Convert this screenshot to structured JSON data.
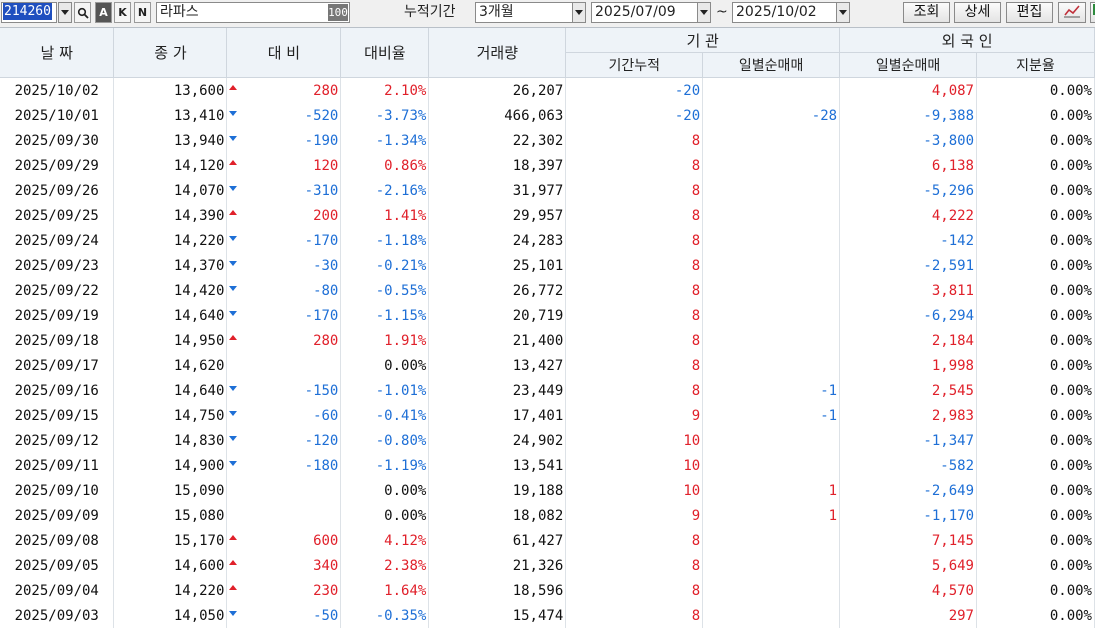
{
  "toolbar": {
    "code": "214260",
    "btn_a": "A",
    "btn_k": "K",
    "btn_n": "N",
    "name": "라파스",
    "badge": "100",
    "period_label": "누적기간",
    "period": "3개월",
    "start_date": "2025/07/09",
    "tilde": "~",
    "end_date": "2025/10/02",
    "search": "조회",
    "detail": "상세",
    "edit": "편집"
  },
  "columns": {
    "date": "날 짜",
    "close": "종 가",
    "change": "대 비",
    "rate": "대비율",
    "volume": "거래량",
    "inst_group": "기 관",
    "inst_cum": "기간누적",
    "inst_daily": "일별순매매",
    "foreign_group": "외 국 인",
    "foreign_daily": "일별순매매",
    "foreign_ratio": "지분율"
  },
  "colors": {
    "up": "#e0202a",
    "down": "#1e6fd6",
    "neutral": "#111111",
    "header": "#eef3f8"
  },
  "rows": [
    {
      "date": "2025/10/02",
      "close": "13,600",
      "dir": "up",
      "change": "280",
      "rate": "2.10%",
      "volume": "26,207",
      "inst_cum": "-20",
      "inst_daily": "",
      "foreign_daily": "4,087",
      "foreign_ratio": "0.00%"
    },
    {
      "date": "2025/10/01",
      "close": "13,410",
      "dir": "down",
      "change": "-520",
      "rate": "-3.73%",
      "volume": "466,063",
      "inst_cum": "-20",
      "inst_daily": "-28",
      "foreign_daily": "-9,388",
      "foreign_ratio": "0.00%"
    },
    {
      "date": "2025/09/30",
      "close": "13,940",
      "dir": "down",
      "change": "-190",
      "rate": "-1.34%",
      "volume": "22,302",
      "inst_cum": "8",
      "inst_daily": "",
      "foreign_daily": "-3,800",
      "foreign_ratio": "0.00%"
    },
    {
      "date": "2025/09/29",
      "close": "14,120",
      "dir": "up",
      "change": "120",
      "rate": "0.86%",
      "volume": "18,397",
      "inst_cum": "8",
      "inst_daily": "",
      "foreign_daily": "6,138",
      "foreign_ratio": "0.00%"
    },
    {
      "date": "2025/09/26",
      "close": "14,070",
      "dir": "down",
      "change": "-310",
      "rate": "-2.16%",
      "volume": "31,977",
      "inst_cum": "8",
      "inst_daily": "",
      "foreign_daily": "-5,296",
      "foreign_ratio": "0.00%"
    },
    {
      "date": "2025/09/25",
      "close": "14,390",
      "dir": "up",
      "change": "200",
      "rate": "1.41%",
      "volume": "29,957",
      "inst_cum": "8",
      "inst_daily": "",
      "foreign_daily": "4,222",
      "foreign_ratio": "0.00%"
    },
    {
      "date": "2025/09/24",
      "close": "14,220",
      "dir": "down",
      "change": "-170",
      "rate": "-1.18%",
      "volume": "24,283",
      "inst_cum": "8",
      "inst_daily": "",
      "foreign_daily": "-142",
      "foreign_ratio": "0.00%"
    },
    {
      "date": "2025/09/23",
      "close": "14,370",
      "dir": "down",
      "change": "-30",
      "rate": "-0.21%",
      "volume": "25,101",
      "inst_cum": "8",
      "inst_daily": "",
      "foreign_daily": "-2,591",
      "foreign_ratio": "0.00%"
    },
    {
      "date": "2025/09/22",
      "close": "14,420",
      "dir": "down",
      "change": "-80",
      "rate": "-0.55%",
      "volume": "26,772",
      "inst_cum": "8",
      "inst_daily": "",
      "foreign_daily": "3,811",
      "foreign_ratio": "0.00%"
    },
    {
      "date": "2025/09/19",
      "close": "14,640",
      "dir": "down",
      "change": "-170",
      "rate": "-1.15%",
      "volume": "20,719",
      "inst_cum": "8",
      "inst_daily": "",
      "foreign_daily": "-6,294",
      "foreign_ratio": "0.00%"
    },
    {
      "date": "2025/09/18",
      "close": "14,950",
      "dir": "up",
      "change": "280",
      "rate": "1.91%",
      "volume": "21,400",
      "inst_cum": "8",
      "inst_daily": "",
      "foreign_daily": "2,184",
      "foreign_ratio": "0.00%"
    },
    {
      "date": "2025/09/17",
      "close": "14,620",
      "dir": "flat",
      "change": "",
      "rate": "0.00%",
      "volume": "13,427",
      "inst_cum": "8",
      "inst_daily": "",
      "foreign_daily": "1,998",
      "foreign_ratio": "0.00%"
    },
    {
      "date": "2025/09/16",
      "close": "14,640",
      "dir": "down",
      "change": "-150",
      "rate": "-1.01%",
      "volume": "23,449",
      "inst_cum": "8",
      "inst_daily": "-1",
      "foreign_daily": "2,545",
      "foreign_ratio": "0.00%"
    },
    {
      "date": "2025/09/15",
      "close": "14,750",
      "dir": "down",
      "change": "-60",
      "rate": "-0.41%",
      "volume": "17,401",
      "inst_cum": "9",
      "inst_daily": "-1",
      "foreign_daily": "2,983",
      "foreign_ratio": "0.00%"
    },
    {
      "date": "2025/09/12",
      "close": "14,830",
      "dir": "down",
      "change": "-120",
      "rate": "-0.80%",
      "volume": "24,902",
      "inst_cum": "10",
      "inst_daily": "",
      "foreign_daily": "-1,347",
      "foreign_ratio": "0.00%"
    },
    {
      "date": "2025/09/11",
      "close": "14,900",
      "dir": "down",
      "change": "-180",
      "rate": "-1.19%",
      "volume": "13,541",
      "inst_cum": "10",
      "inst_daily": "",
      "foreign_daily": "-582",
      "foreign_ratio": "0.00%"
    },
    {
      "date": "2025/09/10",
      "close": "15,090",
      "dir": "flat",
      "change": "",
      "rate": "0.00%",
      "volume": "19,188",
      "inst_cum": "10",
      "inst_daily": "1",
      "foreign_daily": "-2,649",
      "foreign_ratio": "0.00%"
    },
    {
      "date": "2025/09/09",
      "close": "15,080",
      "dir": "flat",
      "change": "",
      "rate": "0.00%",
      "volume": "18,082",
      "inst_cum": "9",
      "inst_daily": "1",
      "foreign_daily": "-1,170",
      "foreign_ratio": "0.00%"
    },
    {
      "date": "2025/09/08",
      "close": "15,170",
      "dir": "up",
      "change": "600",
      "rate": "4.12%",
      "volume": "61,427",
      "inst_cum": "8",
      "inst_daily": "",
      "foreign_daily": "7,145",
      "foreign_ratio": "0.00%"
    },
    {
      "date": "2025/09/05",
      "close": "14,600",
      "dir": "up",
      "change": "340",
      "rate": "2.38%",
      "volume": "21,326",
      "inst_cum": "8",
      "inst_daily": "",
      "foreign_daily": "5,649",
      "foreign_ratio": "0.00%"
    },
    {
      "date": "2025/09/04",
      "close": "14,220",
      "dir": "up",
      "change": "230",
      "rate": "1.64%",
      "volume": "18,596",
      "inst_cum": "8",
      "inst_daily": "",
      "foreign_daily": "4,570",
      "foreign_ratio": "0.00%"
    },
    {
      "date": "2025/09/03",
      "close": "14,050",
      "dir": "down",
      "change": "-50",
      "rate": "-0.35%",
      "volume": "15,474",
      "inst_cum": "8",
      "inst_daily": "",
      "foreign_daily": "297",
      "foreign_ratio": "0.00%"
    }
  ]
}
